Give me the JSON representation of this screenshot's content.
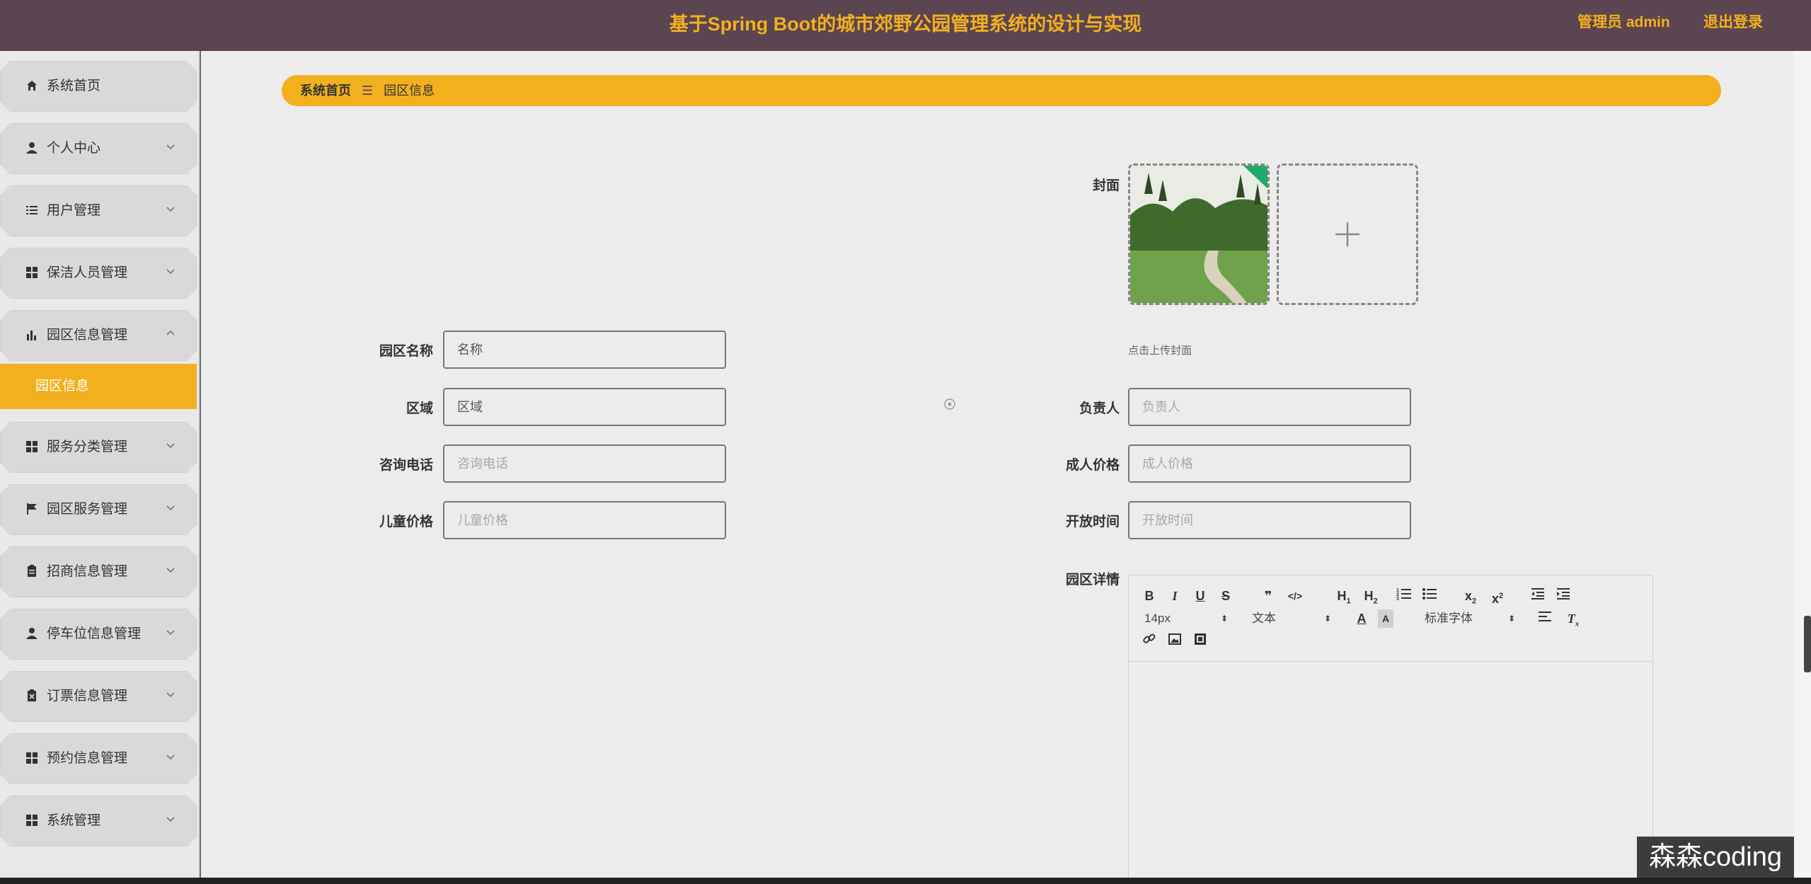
{
  "header": {
    "title": "基于Spring Boot的城市郊野公园管理系统的设计与实现",
    "admin_label": "管理员 admin",
    "logout_label": "退出登录"
  },
  "sidebar": {
    "items": [
      {
        "label": "系统首页",
        "icon": "home-icon"
      },
      {
        "label": "个人中心",
        "icon": "person-icon"
      },
      {
        "label": "用户管理",
        "icon": "list-icon"
      },
      {
        "label": "保洁人员管理",
        "icon": "grid-icon"
      },
      {
        "label": "园区信息管理",
        "icon": "bar-chart-icon"
      },
      {
        "label": "服务分类管理",
        "icon": "grid-icon"
      },
      {
        "label": "园区服务管理",
        "icon": "flag-icon"
      },
      {
        "label": "招商信息管理",
        "icon": "clipboard-icon"
      },
      {
        "label": "停车位信息管理",
        "icon": "person-icon"
      },
      {
        "label": "订票信息管理",
        "icon": "clipboard-x-icon"
      },
      {
        "label": "预约信息管理",
        "icon": "grid-icon"
      },
      {
        "label": "系统管理",
        "icon": "grid-icon"
      }
    ],
    "active_sub": "园区信息",
    "accent": "#f2b01e"
  },
  "breadcrumb": {
    "home": "系统首页",
    "separator": "☰",
    "current": "园区信息"
  },
  "form": {
    "cover_label": "封面",
    "upload_hint": "点击上传封面",
    "name_label": "园区名称",
    "name_value": "名称",
    "region_label": "区域",
    "region_value": "区域",
    "phone_label": "咨询电话",
    "phone_placeholder": "咨询电话",
    "child_price_label": "儿童价格",
    "child_price_placeholder": "儿童价格",
    "manager_label": "负责人",
    "manager_placeholder": "负责人",
    "adult_price_label": "成人价格",
    "adult_price_placeholder": "成人价格",
    "open_time_label": "开放时间",
    "open_time_placeholder": "开放时间",
    "detail_label": "园区详情"
  },
  "editor": {
    "font_size": "14px",
    "block_type": "文本",
    "font_family": "标准字体"
  },
  "watermark": "森森coding"
}
